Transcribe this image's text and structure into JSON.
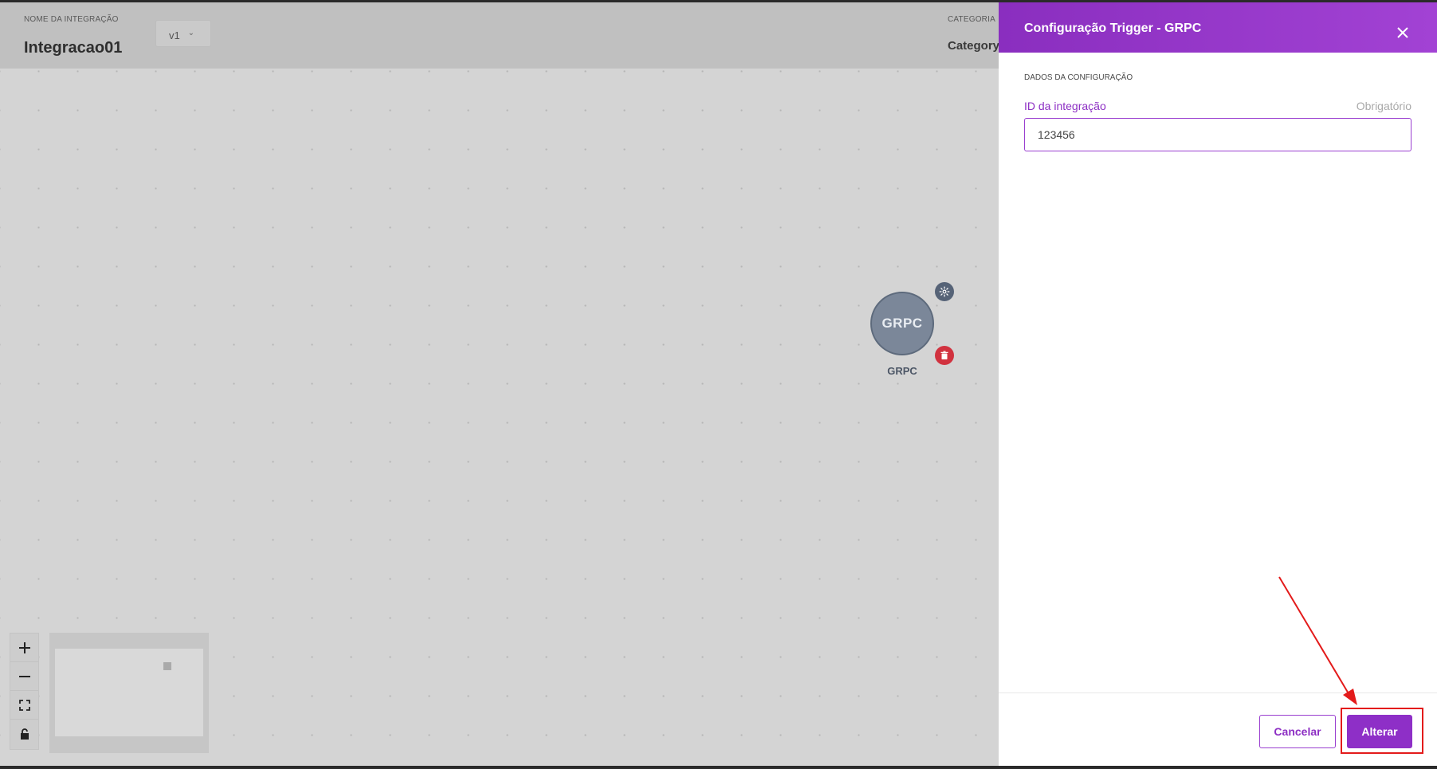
{
  "header": {
    "integration_caption": "NOME DA INTEGRAÇÃO",
    "integration_name": "Integracao01",
    "version": "v1",
    "category_caption": "CATEGORIA",
    "category_value": "Category"
  },
  "canvas": {
    "node": {
      "icon_text": "GRPC",
      "label": "GRPC"
    },
    "controls": [
      "zoom-in",
      "zoom-out",
      "fit-view",
      "lock"
    ]
  },
  "drawer": {
    "title": "Configuração Trigger - GRPC",
    "section_caption": "DADOS DA CONFIGURAÇÃO",
    "field_label": "ID da integração",
    "field_required": "Obrigatório",
    "field_value": "123456",
    "cancel_label": "Cancelar",
    "save_label": "Alterar"
  },
  "colors": {
    "accent": "#8e2fc7",
    "delete": "#d1323f",
    "node": "#7b8799",
    "annotation": "#e31b1b"
  }
}
